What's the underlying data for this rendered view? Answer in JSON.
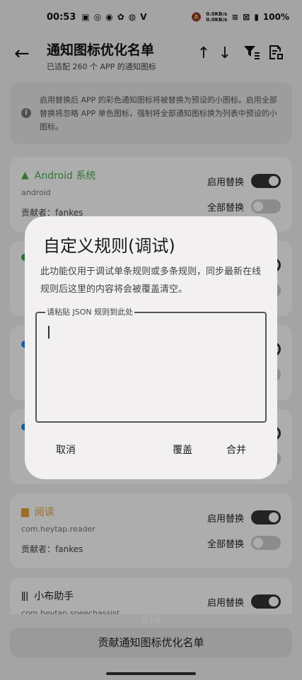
{
  "status_bar": {
    "time": "00:53",
    "speed_up": "0.0KB/s",
    "speed_down": "0.0KB/s",
    "battery": "100%"
  },
  "app_bar": {
    "title": "通知图标优化名单",
    "subtitle": "已适配 260 个 APP 的通知图标"
  },
  "info": {
    "text": "启用替换后 APP 的彩色通知图标将被替换为预设的小图标。启用全部替换将忽略 APP 单色图标，强制将全部通知图标换为列表中预设的小图标。"
  },
  "labels": {
    "enable_replace": "启用替换",
    "replace_all": "全部替换",
    "contributor_prefix": "贡献者："
  },
  "apps": [
    {
      "name": "Android 系统",
      "package": "android",
      "contributor": "fankes",
      "color": "#4caf50",
      "enable_on": true,
      "all_on": false
    },
    {
      "name": "阅读",
      "package": "com.heytap.reader",
      "contributor": "fankes",
      "color": "#e6a23c",
      "enable_on": true,
      "all_on": false
    },
    {
      "name": "小布助手",
      "package": "com.heytap.speechassist",
      "color": "#222222",
      "enable_on": true
    }
  ],
  "hidden_cards_dots": [
    "#3fa34d",
    "#1e88e5",
    "#1e88e5"
  ],
  "pager": "4/4",
  "bottom_button": "贡献通知图标优化名单",
  "dialog": {
    "title": "自定义规则(调试)",
    "body": "此功能仅用于调试单条规则或多条规则，同步最新在线规则后这里的内容将会被覆盖清空。",
    "field_label": "请粘贴 JSON 规则到此处",
    "field_value": "",
    "cancel": "取消",
    "overwrite": "覆盖",
    "merge": "合并"
  }
}
